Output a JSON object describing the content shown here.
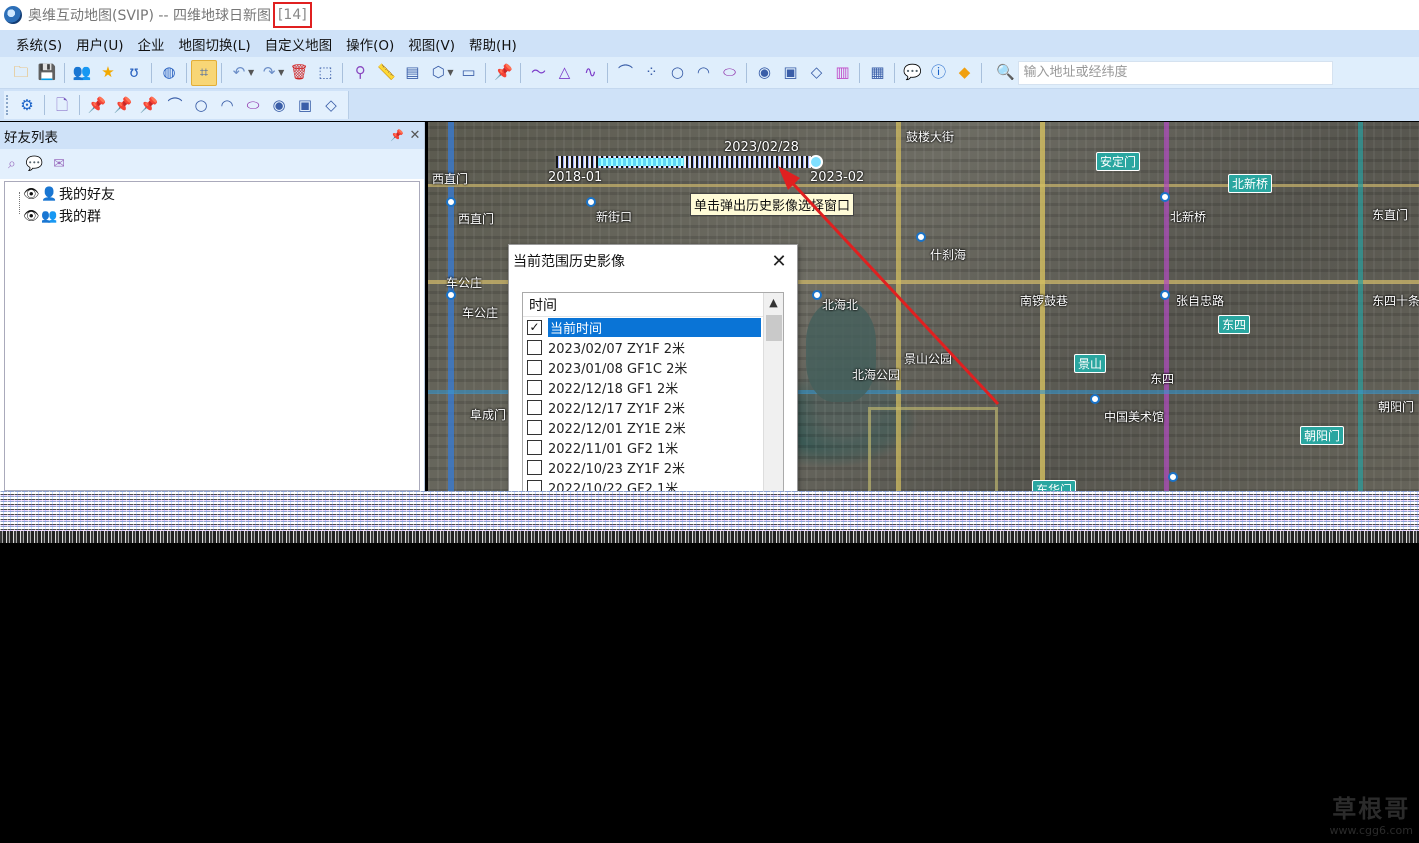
{
  "window": {
    "title": "奥维互动地图(SVIP) -- 四维地球日新图",
    "count_badge": "[14]"
  },
  "menu": [
    "系统(S)",
    "用户(U)",
    "企业",
    "地图切换(L)",
    "自定义地图",
    "操作(O)",
    "视图(V)",
    "帮助(H)"
  ],
  "toolbar": {
    "search_placeholder": "输入地址或经纬度"
  },
  "sidepanel": {
    "title": "好友列表",
    "pin_glyph": "📌",
    "close_glyph": "✕",
    "tree": [
      {
        "label": "我的好友"
      },
      {
        "label": "我的群"
      }
    ]
  },
  "map": {
    "timeline": {
      "start": "2018-01",
      "end": "2023-02",
      "current": "2023/02/28"
    },
    "callout": "单击弹出历史影像选择窗口",
    "labels": [
      {
        "text": "西直门"
      },
      {
        "text": "西直门"
      },
      {
        "text": "新街口"
      },
      {
        "text": "车公庄"
      },
      {
        "text": "车公庄"
      },
      {
        "text": "阜成门"
      },
      {
        "text": "北海北"
      },
      {
        "text": "北海公园"
      },
      {
        "text": "景山公园"
      },
      {
        "text": "什刹海"
      },
      {
        "text": "南锣鼓巷"
      },
      {
        "text": "张自忠路"
      },
      {
        "text": "北新桥"
      },
      {
        "text": "鼓楼大街"
      },
      {
        "text": "东四"
      },
      {
        "text": "中国美术馆"
      },
      {
        "text": "朝阳门"
      },
      {
        "text": "东四十条"
      },
      {
        "text": "东直门"
      }
    ],
    "metro_signs": [
      {
        "text": "安定门"
      },
      {
        "text": "北新桥"
      },
      {
        "text": "东四"
      },
      {
        "text": "景山"
      },
      {
        "text": "朝阳门"
      },
      {
        "text": "东华门"
      }
    ]
  },
  "dialog": {
    "title": "当前范围历史影像",
    "close_glyph": "✕",
    "column_header": "时间",
    "rows": [
      {
        "label": "当前时间",
        "checked": true,
        "selected": true
      },
      {
        "label": "2023/02/07 ZY1F  2米",
        "checked": false
      },
      {
        "label": "2023/01/08 GF1C  2米",
        "checked": false
      },
      {
        "label": "2022/12/18 GF1   2米",
        "checked": false
      },
      {
        "label": "2022/12/17 ZY1F  2米",
        "checked": false
      },
      {
        "label": "2022/12/01 ZY1E  2米",
        "checked": false
      },
      {
        "label": "2022/11/01 GF2   1米",
        "checked": false
      },
      {
        "label": "2022/10/23 ZY1F  2米",
        "checked": false
      },
      {
        "label": "2022/10/22 GF2   1米",
        "checked": false
      }
    ]
  },
  "watermark": {
    "main": "草根哥",
    "sub": "www.cgg6.com"
  },
  "colors": {
    "menubar_bg": "#cfe2f8",
    "toolbar_bg": "#dfeefc",
    "selected_row": "#0a74d6",
    "annotation_red": "#e02020",
    "metro_sign": "#2aa6a0"
  }
}
